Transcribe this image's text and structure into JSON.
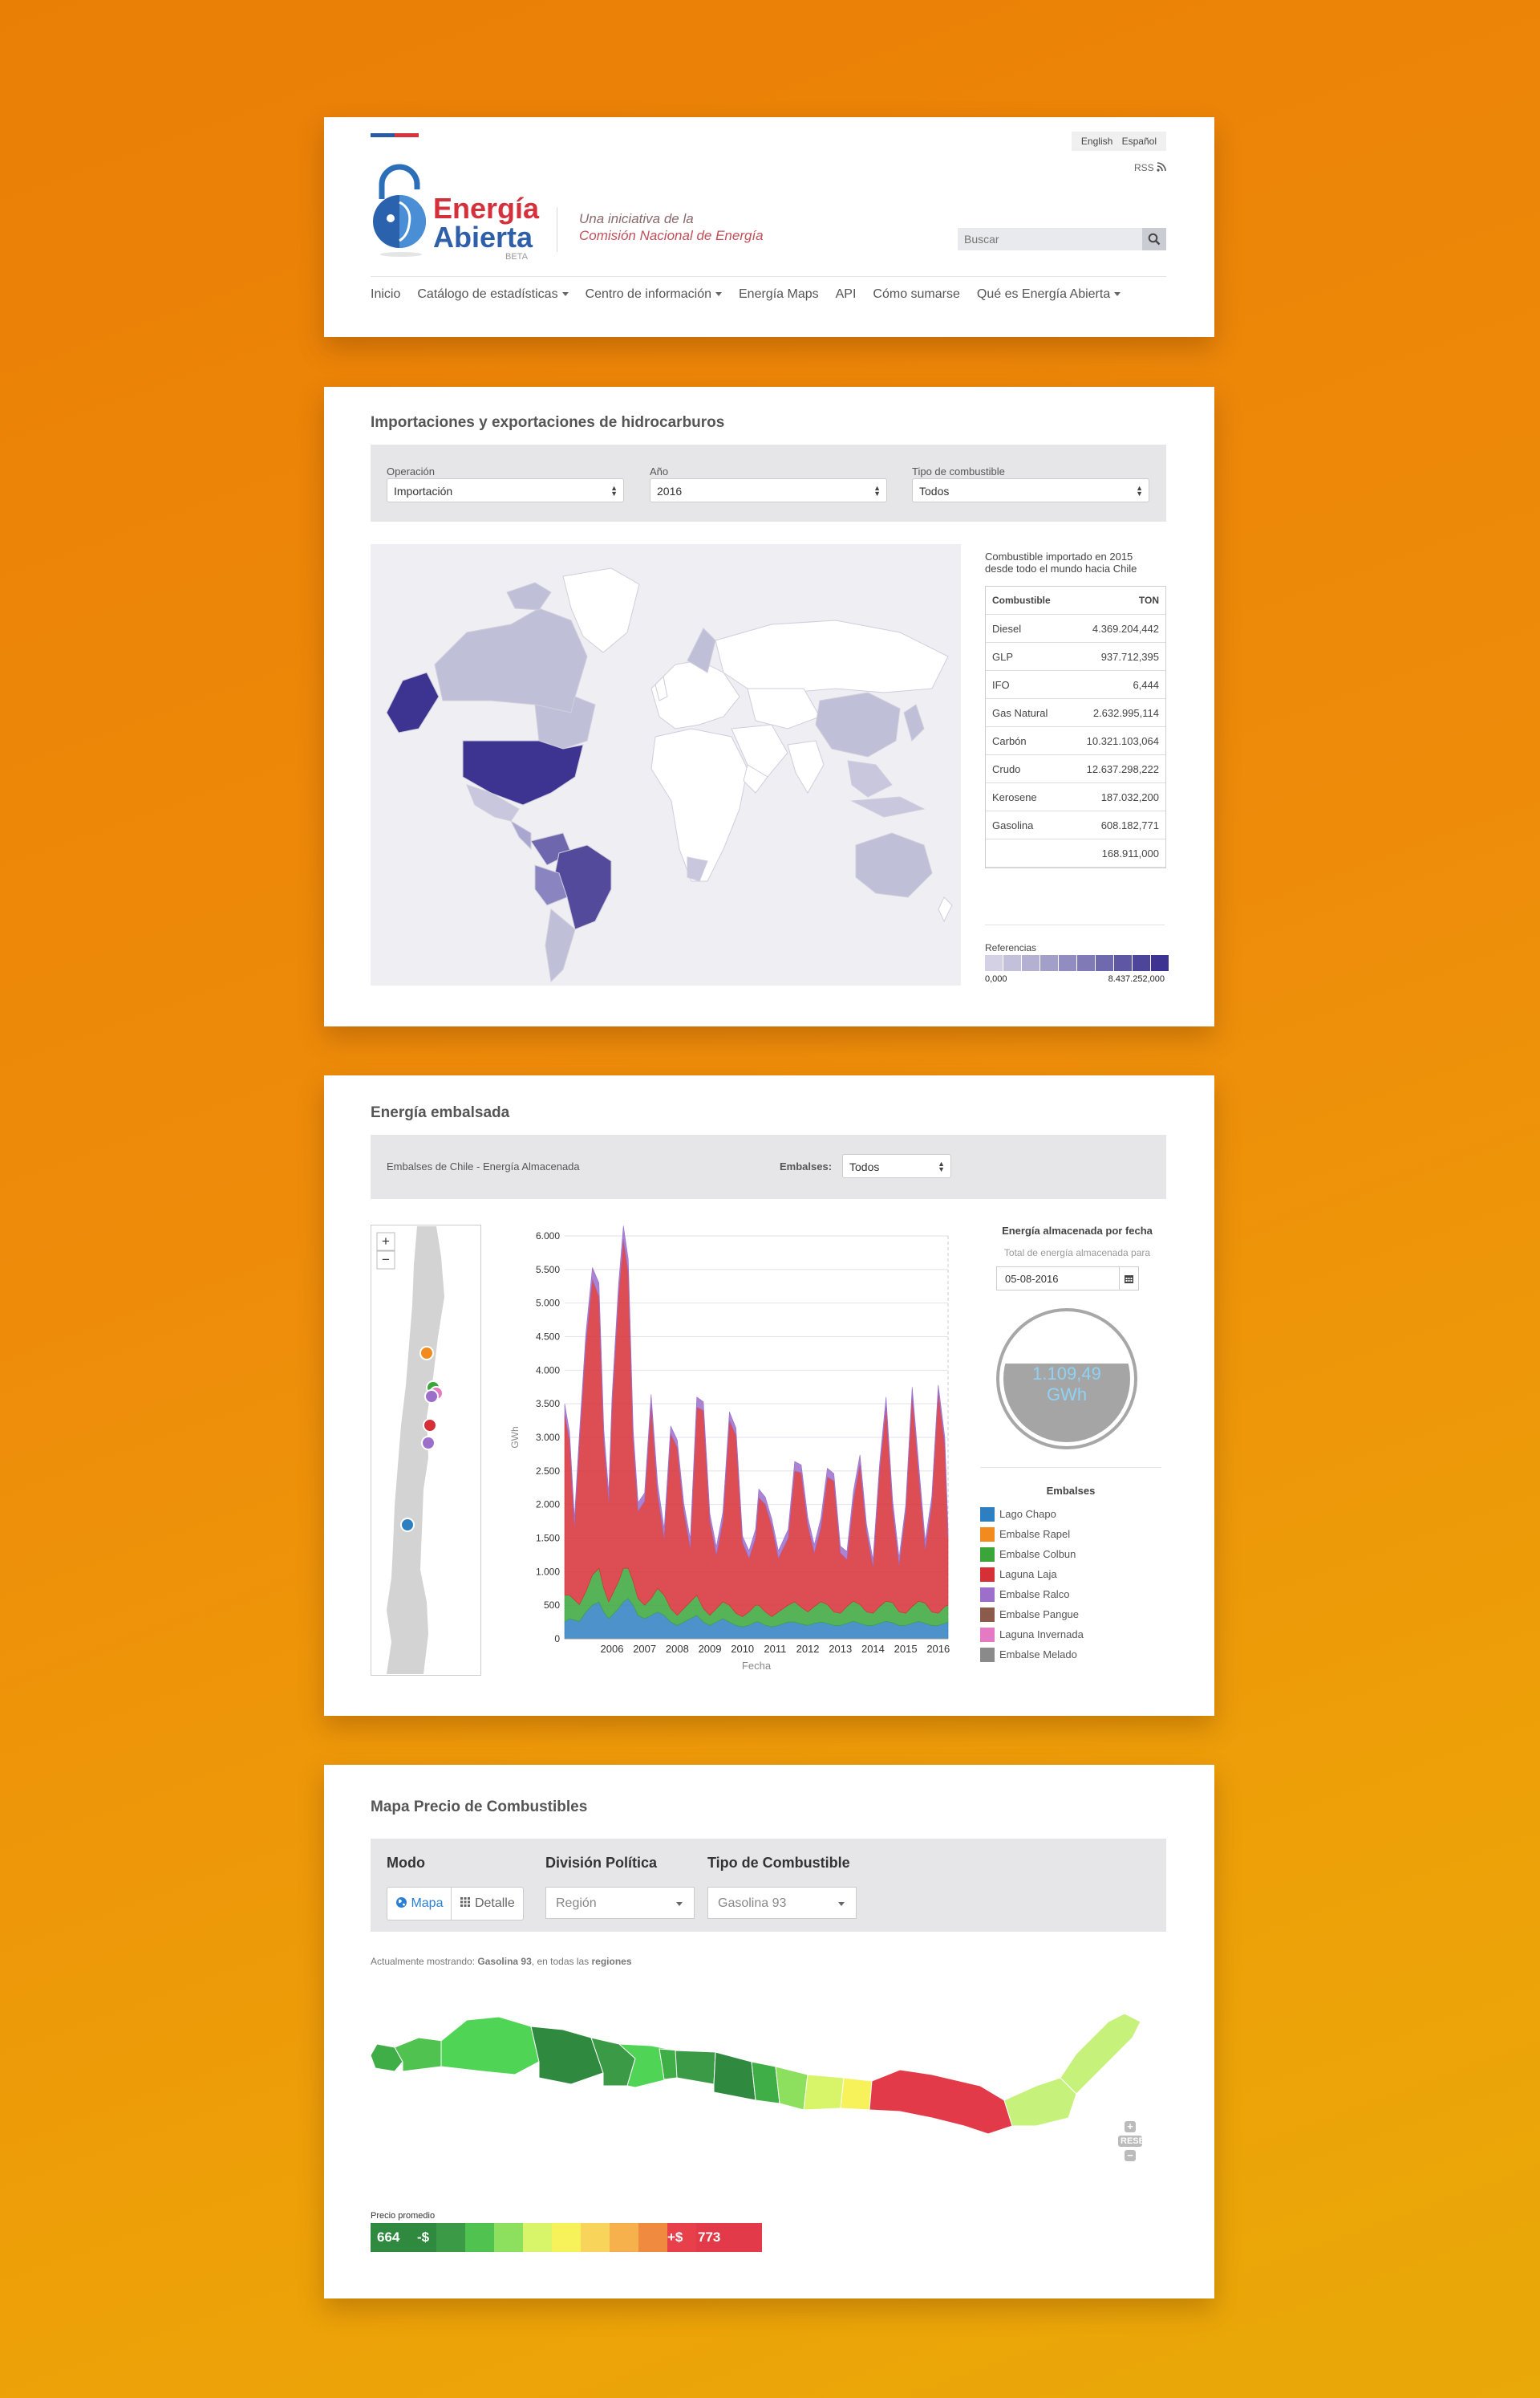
{
  "header": {
    "lang_english": "English",
    "lang_spanish": "Español",
    "rss": "RSS",
    "logo_line1": "Energía",
    "logo_line2": "Abierta",
    "logo_badge": "BETA",
    "tagline_line1": "Una iniciativa de la",
    "tagline_line2": "Comisión Nacional de Energía",
    "search_placeholder": "Buscar",
    "nav": [
      "Inicio",
      "Catálogo de estadísticas",
      "Centro de información",
      "Energía Maps",
      "API",
      "Cómo sumarse",
      "Qué es Energía Abierta"
    ]
  },
  "hydrocarbons": {
    "title": "Importaciones y exportaciones de hidrocarburos",
    "filters": [
      {
        "label": "Operación",
        "value": "Importación"
      },
      {
        "label": "Año",
        "value": "2016"
      },
      {
        "label": "Tipo de combustible",
        "value": "Todos"
      }
    ],
    "caption_line1": "Combustible importado en 2015",
    "caption_line2": "desde todo el mundo hacia Chile",
    "table_header": [
      "Combustible",
      "TON"
    ],
    "table_rows": [
      [
        "Diesel",
        "4.369.204,442"
      ],
      [
        "GLP",
        "937.712,395"
      ],
      [
        "IFO",
        "6,444"
      ],
      [
        "Gas Natural",
        "2.632.995,114"
      ],
      [
        "Carbón",
        "10.321.103,064"
      ],
      [
        "Crudo",
        "12.637.298,222"
      ],
      [
        "Kerosene",
        "187.032,200"
      ],
      [
        "Gasolina",
        "608.182,771"
      ],
      [
        "",
        "168.911,000"
      ]
    ],
    "legend_title": "Referencias",
    "legend_min": "0,000",
    "legend_max": "8.437.252,000",
    "legend_colors": [
      "#d3d1e3",
      "#c2c0da",
      "#b3b0d2",
      "#a29fc9",
      "#918dc0",
      "#807bb7",
      "#6f69ad",
      "#5e57a4",
      "#4d459a",
      "#3c3490"
    ]
  },
  "energy": {
    "title": "Energía embalsada",
    "bar_label": "Embalses de Chile - Energía Almacenada",
    "select_label": "Embalses:",
    "select_value": "Todos",
    "zoom_in": "+",
    "zoom_out": "−",
    "side_title": "Energía almacenada por fecha",
    "side_sub": "Total de energía almacenada para",
    "date_value": "05-08-2016",
    "gauge_value": "1.109,49",
    "gauge_unit": "GWh",
    "gauge_fill_fraction": 0.62,
    "legend_title": "Embalses",
    "reservoirs": [
      {
        "name": "Lago Chapo",
        "color": "#2e7fc2"
      },
      {
        "name": "Embalse Rapel",
        "color": "#f28a1e"
      },
      {
        "name": "Embalse Colbun",
        "color": "#3aa63a"
      },
      {
        "name": "Laguna Laja",
        "color": "#d62f36"
      },
      {
        "name": "Embalse Ralco",
        "color": "#9b6fca"
      },
      {
        "name": "Embalse Pangue",
        "color": "#8b5a4a"
      },
      {
        "name": "Laguna Invernada",
        "color": "#e57ac4"
      },
      {
        "name": "Embalse Melado",
        "color": "#8a8a8a"
      }
    ]
  },
  "chart_data": {
    "type": "area",
    "xlabel": "Fecha",
    "ylabel": "GWh",
    "ylim": [
      0,
      6000
    ],
    "xlim": [
      2005.05,
      2016.8
    ],
    "yticks": [
      "0",
      "500",
      "1.000",
      "1.500",
      "2.000",
      "2.500",
      "3.000",
      "3.500",
      "4.000",
      "4.500",
      "5.000",
      "5.500",
      "6.000"
    ],
    "xticks": [
      "2006",
      "2007",
      "2008",
      "2009",
      "2010",
      "2011",
      "2012",
      "2013",
      "2014",
      "2015",
      "2016"
    ],
    "grid": true,
    "x": [
      2005.05,
      2005.2,
      2005.35,
      2005.5,
      2005.7,
      2005.9,
      2006.1,
      2006.25,
      2006.4,
      2006.5,
      2006.7,
      2006.85,
      2007.0,
      2007.15,
      2007.3,
      2007.5,
      2007.7,
      2007.9,
      2008.1,
      2008.3,
      2008.5,
      2008.7,
      2008.9,
      2009.1,
      2009.3,
      2009.5,
      2009.7,
      2009.9,
      2010.1,
      2010.3,
      2010.5,
      2010.7,
      2010.9,
      2011.0,
      2011.2,
      2011.4,
      2011.6,
      2011.9,
      2012.1,
      2012.3,
      2012.5,
      2012.7,
      2012.9,
      2013.1,
      2013.3,
      2013.5,
      2013.7,
      2013.9,
      2014.1,
      2014.3,
      2014.5,
      2014.7,
      2014.9,
      2015.1,
      2015.3,
      2015.5,
      2015.7,
      2015.9,
      2016.1,
      2016.3,
      2016.5,
      2016.7,
      2016.8
    ],
    "series": [
      {
        "name": "Lago Chapo",
        "values": [
          250,
          300,
          280,
          260,
          400,
          500,
          550,
          400,
          300,
          350,
          450,
          550,
          600,
          500,
          350,
          300,
          350,
          400,
          350,
          250,
          200,
          250,
          300,
          350,
          250,
          200,
          250,
          300,
          250,
          200,
          180,
          200,
          250,
          250,
          200,
          180,
          200,
          250,
          250,
          220,
          200,
          230,
          250,
          230,
          200,
          200,
          230,
          260,
          230,
          200,
          200,
          230,
          260,
          240,
          200,
          200,
          230,
          260,
          230,
          200,
          200,
          230,
          250
        ]
      },
      {
        "name": "Embalse Colbun",
        "values": [
          400,
          350,
          300,
          250,
          300,
          450,
          500,
          350,
          250,
          300,
          400,
          500,
          450,
          350,
          250,
          200,
          250,
          350,
          300,
          200,
          150,
          200,
          250,
          300,
          200,
          150,
          200,
          250,
          250,
          180,
          150,
          200,
          250,
          250,
          200,
          150,
          200,
          250,
          300,
          250,
          200,
          250,
          300,
          280,
          200,
          180,
          250,
          300,
          280,
          200,
          180,
          250,
          300,
          300,
          200,
          180,
          250,
          300,
          300,
          200,
          180,
          250,
          250
        ]
      },
      {
        "name": "Laguna Laja",
        "values": [
          2700,
          2300,
          1100,
          2400,
          3700,
          4400,
          4050,
          2200,
          1500,
          2800,
          4250,
          4900,
          4400,
          2100,
          1300,
          1550,
          2900,
          1400,
          850,
          2600,
          2500,
          1450,
          800,
          2800,
          2950,
          1400,
          800,
          1200,
          2750,
          2650,
          1100,
          800,
          1000,
          1600,
          1600,
          1350,
          800,
          1000,
          1950,
          2000,
          1300,
          800,
          1100,
          1900,
          1950,
          900,
          700,
          1500,
          2100,
          1200,
          700,
          2000,
          2900,
          1400,
          700,
          1500,
          3150,
          1900,
          800,
          1600,
          3300,
          2400,
          1000
        ]
      },
      {
        "name": "Embalse Ralco",
        "values": [
          150,
          130,
          120,
          130,
          150,
          180,
          200,
          160,
          130,
          140,
          170,
          200,
          200,
          160,
          130,
          120,
          140,
          160,
          140,
          120,
          110,
          120,
          140,
          150,
          130,
          110,
          120,
          140,
          130,
          110,
          100,
          110,
          130,
          130,
          110,
          100,
          110,
          130,
          140,
          120,
          110,
          120,
          140,
          130,
          110,
          100,
          120,
          140,
          130,
          110,
          100,
          120,
          140,
          130,
          110,
          100,
          120,
          140,
          130,
          110,
          100,
          120,
          130
        ]
      }
    ]
  },
  "fuel": {
    "title": "Mapa Precio de Combustibles",
    "mode_label": "Modo",
    "mode_map": "Mapa",
    "mode_detail": "Detalle",
    "division_label": "División Política",
    "division_value": "Región",
    "fuel_label": "Tipo de Combustible",
    "fuel_value": "Gasolina 93",
    "showing_prefix": "Actualmente mostrando: ",
    "showing_fuel": "Gasolina 93",
    "showing_mid": ", en todas las ",
    "showing_regions": "regiones",
    "reset": "RESET",
    "price_label": "Precio promedio",
    "price_min": "664",
    "price_min_sign": "-$",
    "price_max_sign": "+$",
    "price_max": "773",
    "scale_colors": [
      "#2f8a3f",
      "#3b9a45",
      "#4fc24f",
      "#8de05e",
      "#d8f56a",
      "#f7f25a",
      "#f9d45a",
      "#f6b04c",
      "#f08a3e",
      "#e7404b",
      "#e23a48"
    ]
  }
}
